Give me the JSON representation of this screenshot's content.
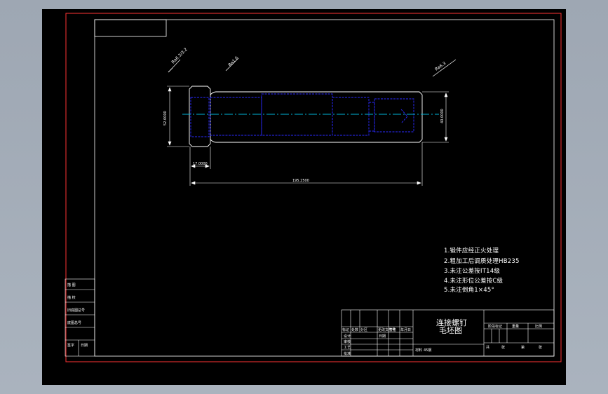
{
  "colors": {
    "background": "#a3acb7",
    "drawing_area": "#000000",
    "outer_frame": "#ff3333",
    "inner_frame": "#ffffff",
    "part_outline": "#ffffff",
    "hidden_lines": "#2a2aff",
    "centerline": "#00b5d8"
  },
  "surface_marks": {
    "left": "Ra6.3/3.2",
    "middle": "Ra1.6",
    "right": "Ra6.3"
  },
  "dimensions": {
    "head_diameter": "52.0000",
    "shank_diameter": "40.0000",
    "head_width": "17.0000",
    "overall_length": "195.2500"
  },
  "notes": [
    "1.锻件应经正火处理",
    "2.粗加工后调质处理HB235",
    "3.未注公差按IT14级",
    "4.未注形位公差按C级",
    "5.未注倒角1×45°"
  ],
  "title_block": {
    "part_name": "连接螺钉",
    "drawing_type": "毛坯图",
    "material_label": "材料",
    "material_value": "45钢",
    "left_labels": [
      "标记",
      "处数",
      "分区",
      "更改文件号",
      "签名",
      "年月日"
    ],
    "role_labels": [
      "设计",
      "审核",
      "工艺",
      "批准"
    ],
    "date_label": "日期",
    "scale_labels": [
      "阶段标记",
      "重量",
      "比例"
    ],
    "sheet_labels": [
      "共",
      "张",
      "第",
      "张"
    ]
  },
  "side_table": {
    "rows": [
      "描  图",
      "描  校",
      "旧底图总号",
      "底图总号",
      "签字",
      "日期"
    ]
  }
}
